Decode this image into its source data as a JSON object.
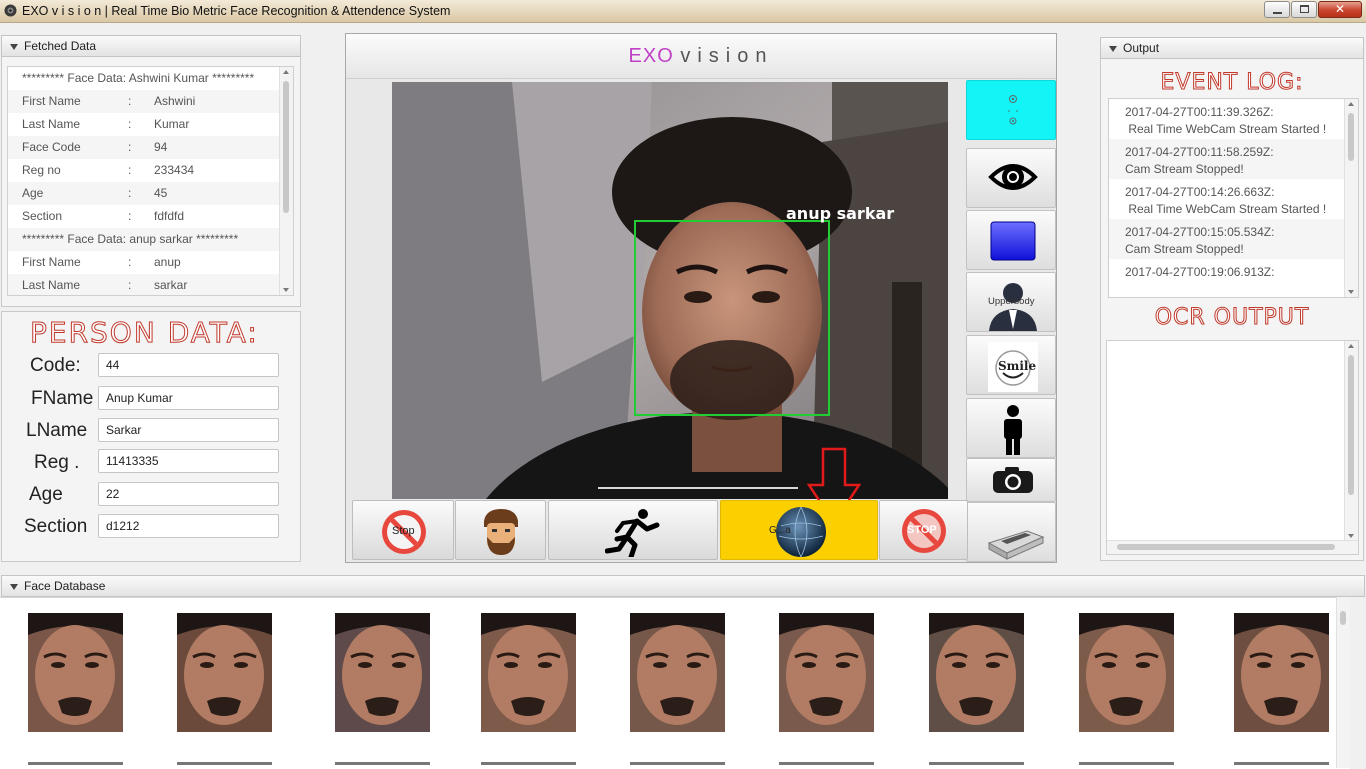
{
  "window": {
    "title": "EXO v i s i o n | Real Time Bio Metric Face Recognition & Attendence System"
  },
  "fetched_data": {
    "header": "Fetched Data",
    "rows": [
      {
        "type": "header",
        "text": "********* Face Data: Ashwini Kumar *********"
      },
      {
        "type": "field",
        "key": "First Name",
        "sep": ":",
        "value": "Ashwini"
      },
      {
        "type": "field",
        "key": "Last Name",
        "sep": ":",
        "value": "Kumar"
      },
      {
        "type": "field",
        "key": "Face Code",
        "sep": ":",
        "value": "94"
      },
      {
        "type": "field",
        "key": "Reg no",
        "sep": ":",
        "value": "233434"
      },
      {
        "type": "field",
        "key": "Age",
        "sep": ":",
        "value": "45"
      },
      {
        "type": "field",
        "key": "Section",
        "sep": ":",
        "value": "fdfdfd"
      },
      {
        "type": "header",
        "text": "********* Face Data: anup sarkar *********"
      },
      {
        "type": "field",
        "key": "First Name",
        "sep": ":",
        "value": "anup"
      },
      {
        "type": "field",
        "key": "Last Name",
        "sep": ":",
        "value": "sarkar"
      }
    ]
  },
  "person_data": {
    "title": "PERSON DATA:",
    "fields": [
      {
        "label": "Code:",
        "value": "44"
      },
      {
        "label": "FName",
        "value": "Anup Kumar"
      },
      {
        "label": "LName",
        "value": "Sarkar"
      },
      {
        "label": "Reg .",
        "value": "11413335"
      },
      {
        "label": "Age",
        "value": "22"
      },
      {
        "label": "Section",
        "value": "d1212"
      }
    ]
  },
  "center": {
    "title_exo": "EXO",
    "title_vision": "vision",
    "detected_name": "anup sarkar",
    "right_tools": [
      {
        "icon": "face-landmarks-icon",
        "label": ""
      },
      {
        "icon": "eye-icon",
        "label": ""
      },
      {
        "icon": "blue-square-icon",
        "label": ""
      },
      {
        "icon": "upperbody-icon",
        "label": "Upperbody"
      },
      {
        "icon": "smile-icon",
        "label": "Smile"
      },
      {
        "icon": "person-icon",
        "label": ""
      },
      {
        "icon": "camera-icon",
        "label": ""
      },
      {
        "icon": "scanner-icon",
        "label": ""
      }
    ],
    "bottom_buttons": [
      {
        "icon": "stop-sign-icon",
        "label": "Stop"
      },
      {
        "icon": "beard-face-icon",
        "label": ""
      },
      {
        "icon": "running-man-icon",
        "label": ""
      },
      {
        "icon": "globe-icon",
        "label": "G...a"
      },
      {
        "icon": "stop-sign-icon",
        "label": "STOP"
      }
    ],
    "accent_active": "#12f4f6",
    "accent_yellow": "#fcd000",
    "face_box_color": "#22cc33"
  },
  "output": {
    "header": "Output",
    "event_log_title": "EVENT LOG:",
    "events": [
      {
        "time": "2017-04-27T00:11:39.326Z:",
        "message": " Real Time WebCam Stream Started !"
      },
      {
        "time": "2017-04-27T00:11:58.259Z:",
        "message": "Cam Stream Stopped!"
      },
      {
        "time": "2017-04-27T00:14:26.663Z:",
        "message": " Real Time WebCam Stream Started !"
      },
      {
        "time": "2017-04-27T00:15:05.534Z:",
        "message": "Cam Stream Stopped!"
      },
      {
        "time": "2017-04-27T00:19:06.913Z:",
        "message": ""
      }
    ],
    "ocr_title": "OCR OUTPUT"
  },
  "face_database": {
    "header": "Face Database",
    "thumbnail_count": 9
  }
}
